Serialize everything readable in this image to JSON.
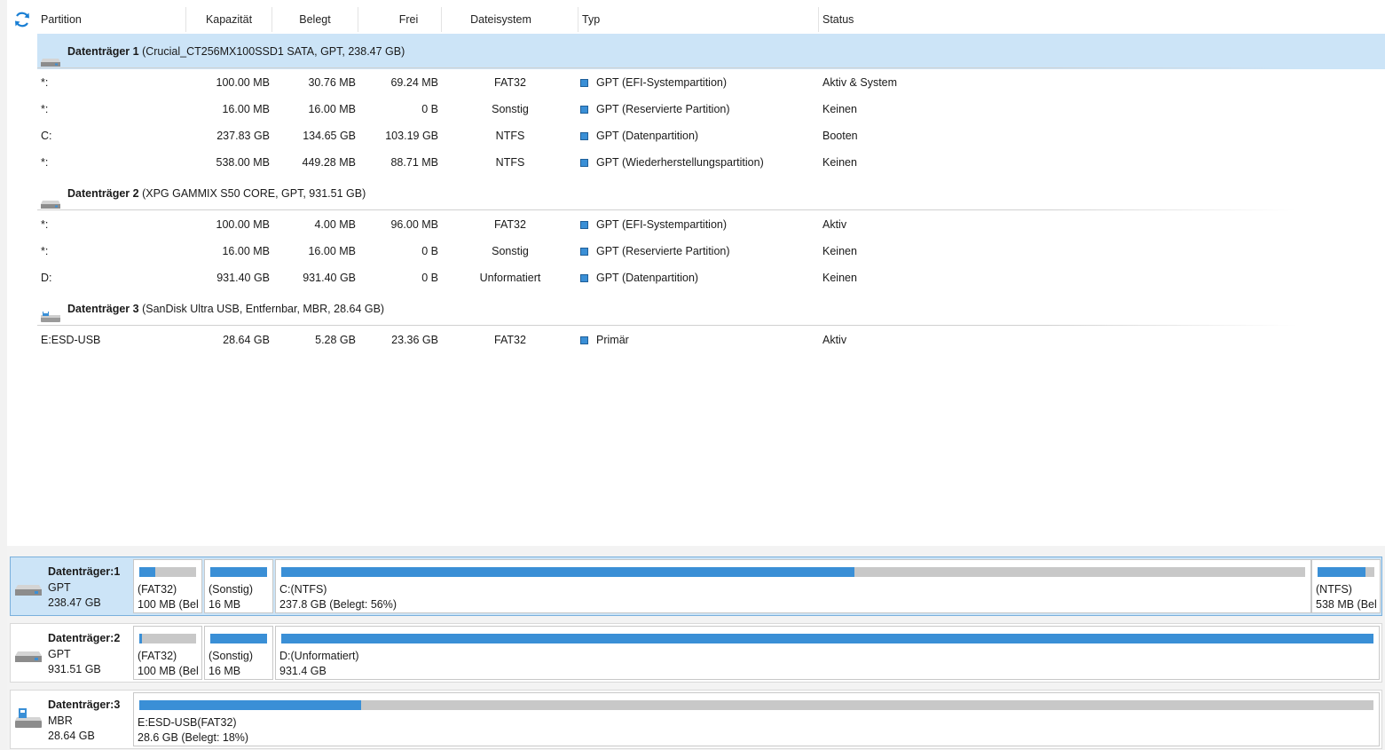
{
  "columns": [
    "Partition",
    "Kapazität",
    "Belegt",
    "Frei",
    "Dateisystem",
    "Typ",
    "Status"
  ],
  "disks": [
    {
      "title": "Datenträger 1",
      "details": "(Crucial_CT256MX100SSD1 SATA, GPT, 238.47 GB)",
      "partitions": [
        {
          "name": "*:",
          "capacity": "100.00 MB",
          "used": "30.76 MB",
          "free": "69.24 MB",
          "fs": "FAT32",
          "type": "GPT (EFI-Systempartition)",
          "status": "Aktiv & System"
        },
        {
          "name": "*:",
          "capacity": "16.00 MB",
          "used": "16.00 MB",
          "free": "0 B",
          "fs": "Sonstig",
          "type": "GPT (Reservierte Partition)",
          "status": "Keinen"
        },
        {
          "name": "C:",
          "capacity": "237.83 GB",
          "used": "134.65 GB",
          "free": "103.19 GB",
          "fs": "NTFS",
          "type": "GPT (Datenpartition)",
          "status": "Booten"
        },
        {
          "name": "*:",
          "capacity": "538.00 MB",
          "used": "449.28 MB",
          "free": "88.71 MB",
          "fs": "NTFS",
          "type": "GPT (Wiederherstellungspartition)",
          "status": "Keinen"
        }
      ]
    },
    {
      "title": "Datenträger 2",
      "details": "(XPG GAMMIX S50 CORE, GPT, 931.51 GB)",
      "partitions": [
        {
          "name": "*:",
          "capacity": "100.00 MB",
          "used": "4.00 MB",
          "free": "96.00 MB",
          "fs": "FAT32",
          "type": "GPT (EFI-Systempartition)",
          "status": "Aktiv"
        },
        {
          "name": "*:",
          "capacity": "16.00 MB",
          "used": "16.00 MB",
          "free": "0 B",
          "fs": "Sonstig",
          "type": "GPT (Reservierte Partition)",
          "status": "Keinen"
        },
        {
          "name": "D:",
          "capacity": "931.40 GB",
          "used": "931.40 GB",
          "free": "0 B",
          "fs": "Unformatiert",
          "type": "GPT (Datenpartition)",
          "status": "Keinen"
        }
      ]
    },
    {
      "title": "Datenträger 3",
      "details": "(SanDisk Ultra USB, Entfernbar, MBR, 28.64 GB)",
      "partitions": [
        {
          "name": "E:ESD-USB",
          "capacity": "28.64 GB",
          "used": "5.28 GB",
          "free": "23.36 GB",
          "fs": "FAT32",
          "type": "Primär",
          "status": "Aktiv"
        }
      ]
    }
  ],
  "map": [
    {
      "name": "Datenträger:1",
      "style": "GPT",
      "size": "238.47 GB",
      "parts": [
        {
          "label": "(FAT32)",
          "size": "100 MB (Bel",
          "used_fraction": 0.28
        },
        {
          "label": "(Sonstig)",
          "size": "16 MB",
          "used_fraction": 1.0
        },
        {
          "label": "C:(NTFS)",
          "size": "237.8 GB (Belegt: 56%)",
          "used_fraction": 0.56
        },
        {
          "label": "(NTFS)",
          "size": "538 MB (Bel",
          "used_fraction": 0.85
        }
      ]
    },
    {
      "name": "Datenträger:2",
      "style": "GPT",
      "size": "931.51 GB",
      "parts": [
        {
          "label": "(FAT32)",
          "size": "100 MB (Bel",
          "used_fraction": 0.04
        },
        {
          "label": "(Sonstig)",
          "size": "16 MB",
          "used_fraction": 1.0
        },
        {
          "label": "D:(Unformatiert)",
          "size": "931.4 GB",
          "used_fraction": 1.0
        }
      ]
    },
    {
      "name": "Datenträger:3",
      "style": "MBR",
      "size": "28.64 GB",
      "parts": [
        {
          "label": "E:ESD-USB(FAT32)",
          "size": "28.6 GB (Belegt: 18%)",
          "used_fraction": 0.18
        }
      ]
    }
  ],
  "colors": {
    "accent": "#3a8fd6",
    "selected": "#cce4f7",
    "bar_empty": "#c8c8c8"
  },
  "icons": {
    "refresh": "refresh-icon",
    "disk": "hard-disk-icon",
    "usb": "usb-drive-icon"
  }
}
